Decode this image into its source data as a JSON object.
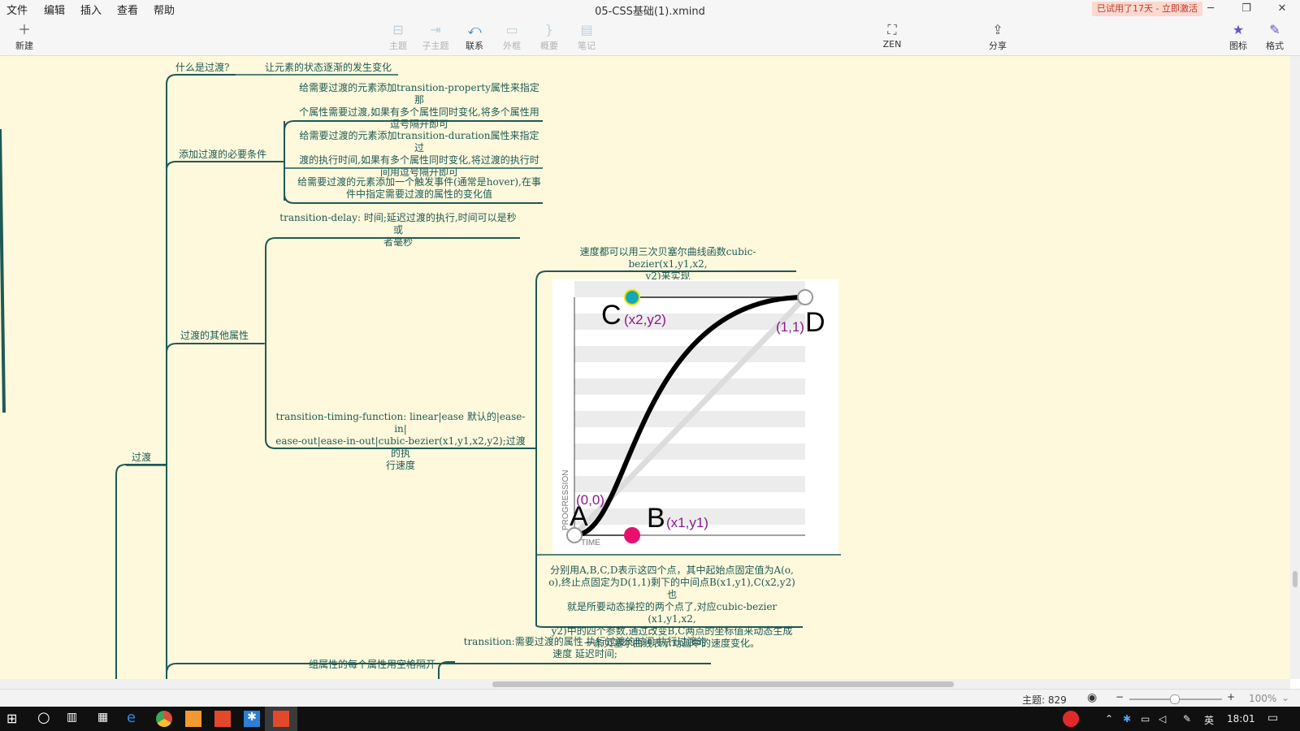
{
  "menu": [
    "文件",
    "编辑",
    "插入",
    "查看",
    "帮助"
  ],
  "window_title": "05-CSS基础(1).xmind",
  "trial_badge": "已试用了17天 - 立即激活",
  "window_controls": {
    "minimize": "─",
    "restore": "❐",
    "close": "✕"
  },
  "toolbar": {
    "new": "新建",
    "topic": "主题",
    "subtopic": "子主题",
    "relationship": "联系",
    "boundary": "外框",
    "summary": "概要",
    "notes": "笔记",
    "zen": "ZEN",
    "share": "分享",
    "icons": "图标",
    "format": "格式"
  },
  "mindmap": {
    "root": "过渡",
    "what_is": {
      "label": "什么是过渡?",
      "answer": "让元素的状态逐渐的发生变化"
    },
    "conditions": {
      "label": "添加过渡的必要条件",
      "items": [
        [
          "给需要过渡的元素添加transition-property属性来指定那",
          "个属性需要过渡,如果有多个属性同时变化,将多个属性用",
          "逗号隔开即可"
        ],
        [
          "给需要过渡的元素添加transition-duration属性来指定过",
          "渡的执行时间,如果有多个属性同时变化,将过渡的执行时",
          "间用逗号隔开即可"
        ],
        [
          "给需要过渡的元素添加一个触发事件(通常是hover),在事",
          "件中指定需要过渡的属性的变化值"
        ]
      ]
    },
    "other_props": {
      "label": "过渡的其他属性",
      "delay": [
        "transition-delay: 时间;延迟过渡的执行,时间可以是秒或",
        "者毫秒"
      ],
      "timing": [
        "transition-timing-function: linear|ease 默认的|ease-in|",
        "ease-out|ease-in-out|cubic-bezier(x1,y1,x2,y2);过渡的执",
        "行速度"
      ],
      "bezier_intro": [
        "速度都可以用三次贝塞尔曲线函数cubic-bezier(x1,y1,x2,",
        "y2)来实现"
      ],
      "bezier_desc": [
        "分别用A,B,C,D表示这四个点，其中起始点固定值为A(o,",
        "o),终止点固定为D(1,1)剩下的中间点B(x1,y1),C(x2,y2)也",
        "就是所要动态操控的两个点了,对应cubic-bezier (x1,y1,x2,",
        "y2)中的四个参数,通过改变B,C两点的坐标值来动态生成",
        "一条贝塞尔曲线表示动画中的速度变化。"
      ]
    },
    "shorthand": [
      "transition:需要过渡的属性 执行过渡的时间 执行过渡的",
      "速度 延迟时间;"
    ],
    "partial": "组属性的每个属性用空格隔开"
  },
  "chart_data": {
    "type": "line",
    "title": "",
    "xlabel": "TIME",
    "ylabel": "PROGRESSION",
    "xlim": [
      0,
      1
    ],
    "ylim": [
      0,
      1
    ],
    "curve": {
      "p0": [
        0,
        0
      ],
      "p1": [
        0.25,
        0
      ],
      "p2": [
        0.25,
        1
      ],
      "p3": [
        1,
        1
      ]
    },
    "diagonal": [
      [
        0,
        0
      ],
      [
        1,
        1
      ]
    ],
    "points": [
      {
        "letter": "A",
        "coord": "(0,0)",
        "x": 0,
        "y": 0,
        "color": "#ffffff"
      },
      {
        "letter": "B",
        "coord": "(x1,y1)",
        "x": 0.25,
        "y": 0,
        "color": "#e8106e"
      },
      {
        "letter": "C",
        "coord": "(x2,y2)",
        "x": 0.25,
        "y": 1,
        "color": "#16a6b6"
      },
      {
        "letter": "D",
        "coord": "(1,1)",
        "x": 1,
        "y": 1,
        "color": "#ffffff"
      }
    ],
    "label_color": "#8a1a8c"
  },
  "status": {
    "topic_count": "主题: 829",
    "zoom": "100%"
  },
  "taskbar": {
    "ime": "英",
    "time": "18:01"
  }
}
